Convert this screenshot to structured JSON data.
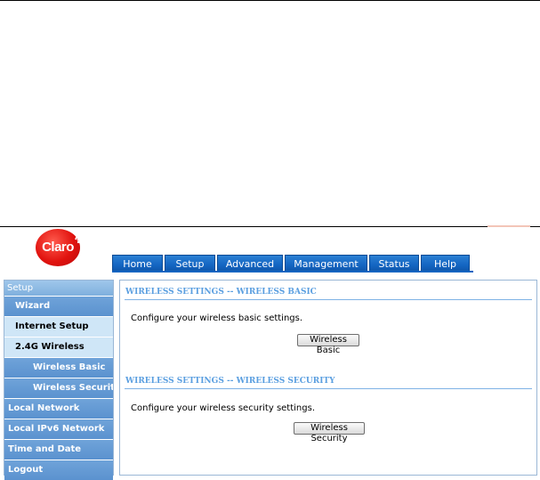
{
  "brand": {
    "logo_text": "Claro",
    "logo_color": "#e1130f"
  },
  "nav": {
    "tabs": [
      {
        "label": "Home"
      },
      {
        "label": "Setup"
      },
      {
        "label": "Advanced"
      },
      {
        "label": "Management"
      },
      {
        "label": "Status"
      },
      {
        "label": "Help"
      }
    ]
  },
  "sidebar": {
    "header": "Setup",
    "items": [
      {
        "label": "Wizard"
      },
      {
        "label": "Internet Setup"
      },
      {
        "label": "2.4G Wireless"
      },
      {
        "label": "Wireless Basic"
      },
      {
        "label": "Wireless Security"
      },
      {
        "label": "Local Network"
      },
      {
        "label": "Local IPv6 Network"
      },
      {
        "label": "Time and Date"
      },
      {
        "label": "Logout"
      }
    ]
  },
  "main": {
    "basic": {
      "title": "WIRELESS SETTINGS -- WIRELESS BASIC",
      "description": "Configure your wireless basic settings.",
      "button": "Wireless Basic"
    },
    "security": {
      "title": "WIRELESS SETTINGS -- WIRELESS SECURITY",
      "description": "Configure your wireless security settings.",
      "button": "Wireless Security"
    }
  },
  "colors": {
    "tab_blue": "#1465c2",
    "sidebar_blue": "#5b92cf",
    "section_title": "#5b9fe0"
  }
}
